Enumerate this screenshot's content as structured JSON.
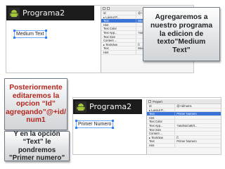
{
  "top_screenshot": {
    "app_title": "Programa2",
    "widget_text": "Medium Text",
    "properties": [
      {
        "key": "Id",
        "value": "@+id/text",
        "selected": false
      },
      {
        "key": "▸ Layout P...",
        "value": "",
        "selected": false
      },
      {
        "key": "Text",
        "value": "Medium T...",
        "selected": true
      },
      {
        "key": "Hint",
        "value": "",
        "selected": false
      },
      {
        "key": "Text Color",
        "value": "",
        "selected": false
      },
      {
        "key": "Text App...",
        "value": "?android:a...",
        "selected": false
      },
      {
        "key": "Text Size",
        "value": "",
        "selected": false
      },
      {
        "key": "Content ...",
        "value": "",
        "selected": false
      },
      {
        "key": "▸ TextView",
        "value": "[]",
        "selected": false
      },
      {
        "key": "Text",
        "value": "Medium T...",
        "selected": false
      },
      {
        "key": "Hint",
        "value": "",
        "selected": false
      }
    ]
  },
  "bottom_screenshot": {
    "app_title": "Programa2",
    "widget_text": "Primer Numero",
    "toolbar_label": "Propert",
    "properties": [
      {
        "key": "Id",
        "value": "@+id/num1",
        "selected": false
      },
      {
        "key": "▸ Layout P...",
        "value": "",
        "selected": false
      },
      {
        "key": "Text",
        "value": "Primer Numero",
        "selected": true
      },
      {
        "key": "Hint",
        "value": "",
        "selected": false
      },
      {
        "key": "Text Color",
        "value": "",
        "selected": false
      },
      {
        "key": "Text App...",
        "value": "?android:attr/t...",
        "selected": false
      },
      {
        "key": "Text Size",
        "value": "",
        "selected": false
      },
      {
        "key": "Content ...",
        "value": "",
        "selected": false
      },
      {
        "key": "▸ TextView",
        "value": "[]",
        "selected": false
      },
      {
        "key": "Text",
        "value": "Primer Numero",
        "selected": false
      },
      {
        "key": "Hint",
        "value": "",
        "selected": false
      }
    ]
  },
  "callouts": {
    "top_right": [
      "Agregaremos a",
      "nuestro programa",
      "la edicion de",
      "texto”Medium",
      "Text”"
    ],
    "left_mid": [
      "Posteriormente",
      "editaremos la",
      "opcion “Id”",
      "agregando”@+id/",
      "num1"
    ],
    "left_bottom": [
      "Y en la opción",
      "“Text” le pondremos",
      "”Primer numero”"
    ]
  },
  "colors": {
    "appbar": "#1c1c1c",
    "selection": "#3874d8",
    "highlight_text": "#b5271e",
    "android_green": "#a4c639"
  }
}
